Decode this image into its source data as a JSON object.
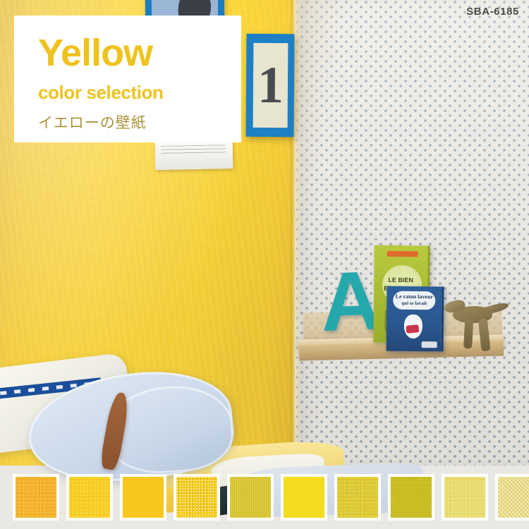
{
  "product": {
    "code": "SBA-6185"
  },
  "caption": {
    "title": "Yellow",
    "subtitle": "color selection",
    "japanese": "イエローの壁紙"
  },
  "scene": {
    "name": "kids-room-yellow-wall",
    "wall_yellow_color": "#fbd63e",
    "wall_dotted_color": "#eceae4",
    "dot_color": "#9aa6b4",
    "framed_poster_numeral": "1",
    "felt_letter": "A",
    "book_green_title_line1": "LE BIEN",
    "book_green_title_line2": "ET LE MAL",
    "book_blue_title_line1": "Le raton laveur",
    "book_blue_title_line2": "qui se lavait"
  },
  "swatches": [
    {
      "name": "swatch-1",
      "color": "#f5b229",
      "texture": "tex-fine"
    },
    {
      "name": "swatch-2",
      "color": "#f9ce22",
      "texture": "tex-fine"
    },
    {
      "name": "swatch-3",
      "color": "#f9c61e",
      "texture": "tex-plain"
    },
    {
      "name": "swatch-4",
      "color": "#f7cc15",
      "texture": "tex-speck"
    },
    {
      "name": "swatch-5",
      "color": "#dcc82e",
      "texture": "tex-linen"
    },
    {
      "name": "swatch-6",
      "color": "#f4dc20",
      "texture": "tex-plain"
    },
    {
      "name": "swatch-7",
      "color": "#dfc932",
      "texture": "tex-fine"
    },
    {
      "name": "swatch-8",
      "color": "#cbbe18",
      "texture": "tex-linen"
    },
    {
      "name": "swatch-9",
      "color": "#e9dc6e",
      "texture": "tex-fine"
    },
    {
      "name": "swatch-10",
      "color": "#ebdc7d",
      "texture": "tex-check"
    }
  ]
}
